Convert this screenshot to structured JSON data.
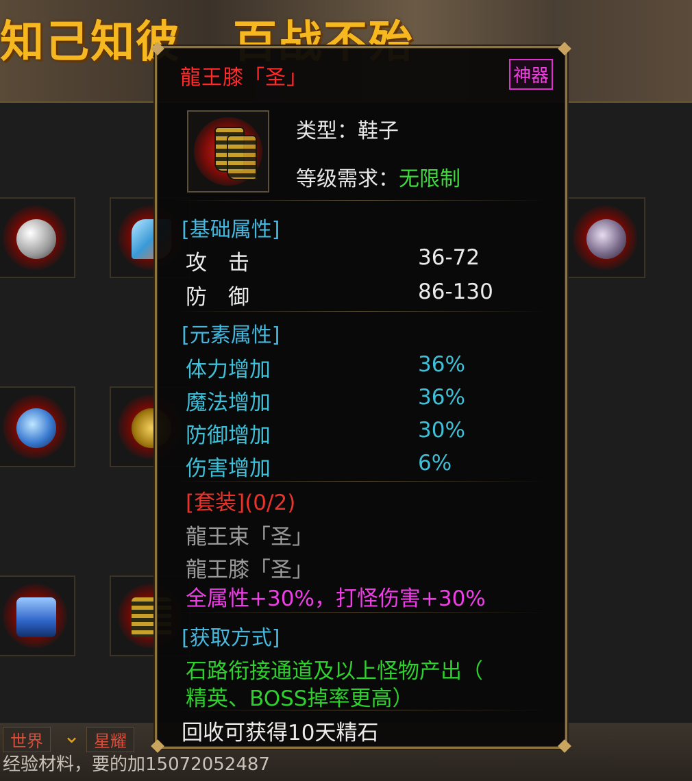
{
  "banner": {
    "left_text": "知己知彼",
    "right_text": "百战不殆"
  },
  "tooltip": {
    "item_name": "龍王膝「圣」",
    "quality_badge": "神器",
    "item_icon": "dragon-boots-icon",
    "type_label": "类型：鞋子",
    "level_req_label": "等级需求：",
    "level_req_value": "无限制",
    "basic": {
      "header": "[基础属性]",
      "stats": [
        {
          "name": "攻　击",
          "value": "36-72"
        },
        {
          "name": "防　御",
          "value": "86-130"
        }
      ]
    },
    "element": {
      "header": "[元素属性]",
      "stats": [
        {
          "name": "体力增加",
          "value": "36%"
        },
        {
          "name": "魔法增加",
          "value": "36%"
        },
        {
          "name": "防御增加",
          "value": "30%"
        },
        {
          "name": "伤害增加",
          "value": "6%"
        }
      ]
    },
    "set": {
      "header": "[套装]",
      "progress": "(0/2)",
      "items": [
        "龍王束「圣」",
        "龍王膝「圣」"
      ],
      "bonus": "全属性+30%，打怪伤害+30%"
    },
    "source": {
      "header": "[获取方式]",
      "lines": [
        "石路衔接通道及以上怪物产出（",
        "精英、BOSS掉率更高）"
      ]
    },
    "recycle": "回收可获得10天精石"
  },
  "chat": {
    "tab_world": "世界",
    "tab_channel": "星耀",
    "line": "经验材料，要的加15072052487"
  },
  "colors": {
    "title_red": "#ff2a2a",
    "badge_magenta": "#e030d0",
    "section_cyan": "#45b8e0",
    "value_green": "#3ddc3d",
    "frame_gold": "#8d7440"
  }
}
